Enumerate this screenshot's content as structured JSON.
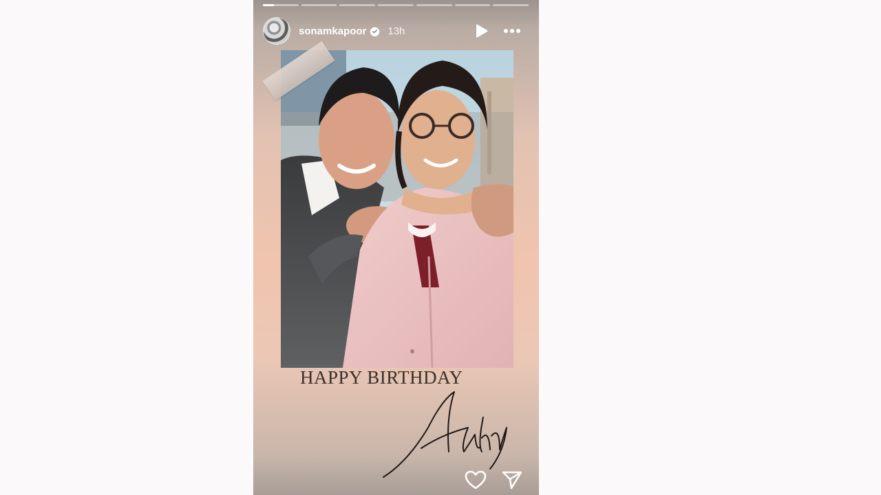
{
  "story": {
    "progress_segments": [
      {
        "fill": 0.3
      },
      {
        "fill": 0
      },
      {
        "fill": 0
      },
      {
        "fill": 0
      },
      {
        "fill": 0
      },
      {
        "fill": 0
      },
      {
        "fill": 0
      }
    ],
    "header": {
      "username": "sonamkapoor",
      "time": "13h",
      "verified": true,
      "icons": {
        "avatar": "profile-avatar",
        "verified": "verified-badge-icon",
        "play": "play-icon",
        "more": "more-options-icon"
      }
    },
    "photo": {
      "description_icon": "photo",
      "colors": {
        "sky": "#b7d1dd",
        "coat": "#eec3c2",
        "jacket": "#4d4e4f"
      }
    },
    "caption": "HAPPY BIRTHDAY",
    "signature": "Akshay",
    "actions": {
      "like_icon": "heart-icon",
      "share_icon": "send-icon"
    }
  }
}
